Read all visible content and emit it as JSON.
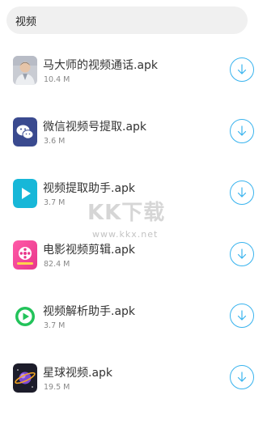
{
  "search": {
    "value": "视频"
  },
  "files": [
    {
      "name": "马大师的视频通话.apk",
      "size": "10.4 M",
      "icon": "person-photo-icon"
    },
    {
      "name": "微信视频号提取.apk",
      "size": "3.6 M",
      "icon": "wechat-icon"
    },
    {
      "name": "视频提取助手.apk",
      "size": "3.7 M",
      "icon": "play-icon"
    },
    {
      "name": "电影视频剪辑.apk",
      "size": "82.4 M",
      "icon": "film-reel-icon"
    },
    {
      "name": "视频解析助手.apk",
      "size": "3.7 M",
      "icon": "green-play-icon"
    },
    {
      "name": "星球视频.apk",
      "size": "19.5 M",
      "icon": "planet-icon"
    }
  ],
  "watermark": {
    "logo": "KK下载",
    "url": "www.kkx.net"
  },
  "colors": {
    "accent": "#38b3ee",
    "search_bg": "#f0f0f0"
  }
}
